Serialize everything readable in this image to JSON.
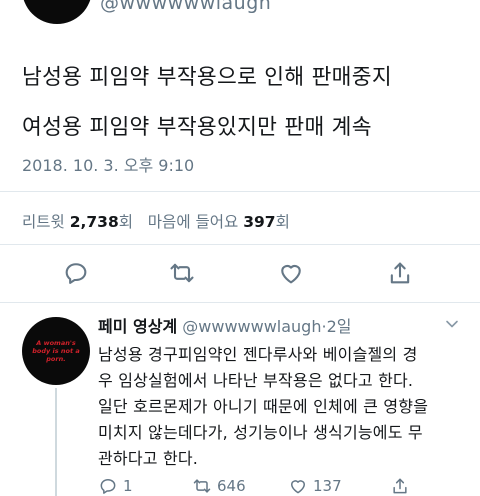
{
  "top_tweet": {
    "handle": "@wwwwwwlaugh",
    "lines": [
      "남성용 피임약 부작용으로 인해 판매중지",
      "여성용 피임약 부작용있지만 판매 계속"
    ],
    "timestamp": "2018. 10. 3. 오후 9:10",
    "retweet_label": "리트윗",
    "retweet_count": "2,738",
    "count_suffix": "회",
    "like_label": "마음에 들어요",
    "like_count": "397",
    "actions": [
      "reply-icon",
      "retweet-icon",
      "like-icon",
      "share-icon"
    ]
  },
  "reply": {
    "avatar_text": "A woman's body is not a porn.",
    "name": "페미 영상계",
    "handle": "@wwwwwwlaugh",
    "separator": "·",
    "time": "2일",
    "lines": [
      "남성용 경구피임약인 젠다루사와 베이슬젤의 경",
      "우 임상실험에서 나타난 부작용은 없다고 한다.",
      "일단 호르몬제가 아니기 때문에 인체에 큰 영향을",
      "미치지 않는데다가, 성기능이나 생식기능에도 무",
      "관하다고 한다."
    ],
    "reply_count": "1",
    "retweet_count": "646",
    "like_count": "137"
  },
  "colors": {
    "text": "#14171a",
    "muted": "#657786",
    "divider": "#e1e8ed",
    "avatar_text": "#d0212a"
  }
}
